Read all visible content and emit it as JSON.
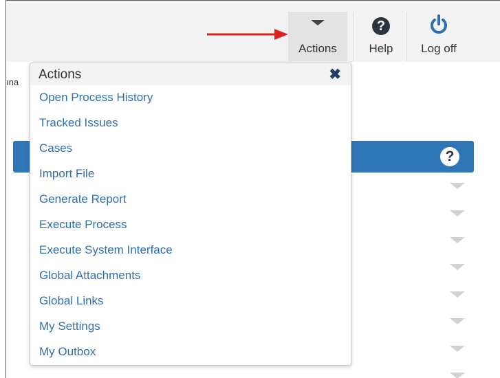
{
  "toolbar": {
    "actions_label": "Actions",
    "help_label": "Help",
    "logoff_label": "Log off",
    "help_glyph": "?"
  },
  "sidebar": {
    "partial_text": "ına"
  },
  "panel": {
    "help_glyph": "?"
  },
  "actions_menu": {
    "title": "Actions",
    "close_glyph": "✖",
    "items": [
      {
        "label": "Open Process History"
      },
      {
        "label": "Tracked Issues"
      },
      {
        "label": "Cases"
      },
      {
        "label": "Import File"
      },
      {
        "label": "Generate Report"
      },
      {
        "label": "Execute Process"
      },
      {
        "label": "Execute System Interface"
      },
      {
        "label": "Global Attachments"
      },
      {
        "label": "Global Links"
      },
      {
        "label": "My Settings"
      },
      {
        "label": "My Outbox"
      }
    ]
  },
  "colors": {
    "accent_blue": "#2f76b6",
    "link_blue": "#2f6fb0",
    "annotation_arrow": "#e0201c"
  }
}
